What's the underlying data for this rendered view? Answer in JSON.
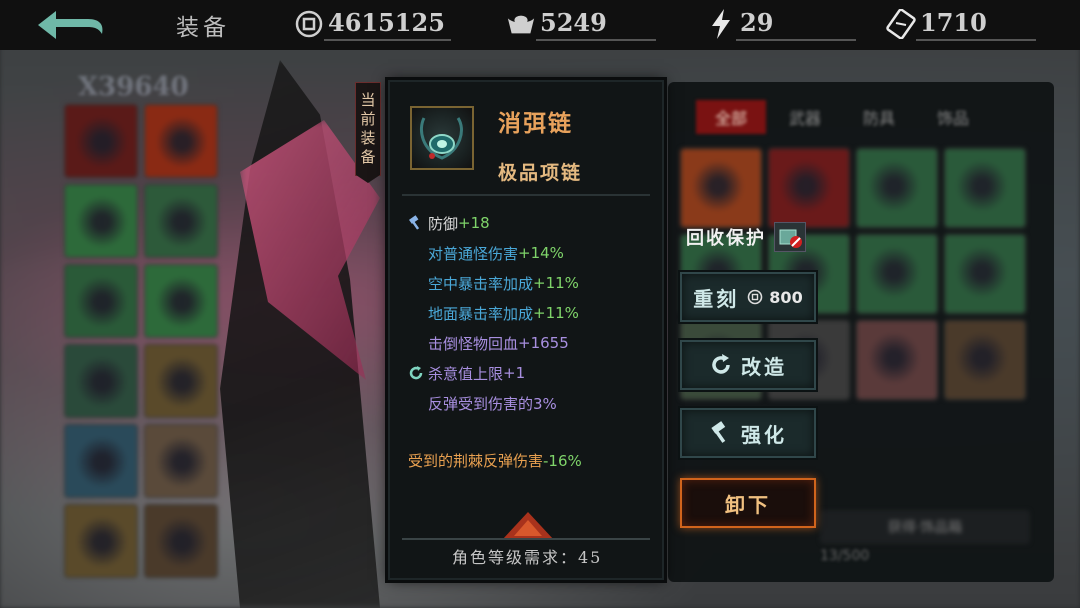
{
  "topbar": {
    "title": "装备",
    "resources": [
      {
        "icon": "coin-icon",
        "value": "4615125"
      },
      {
        "icon": "ingot-icon",
        "value": "5249"
      },
      {
        "icon": "lightning-icon",
        "value": "29"
      },
      {
        "icon": "ticket-icon",
        "value": "1710"
      }
    ]
  },
  "inventory_left": {
    "count": "X39640"
  },
  "current_tag": {
    "chars": [
      "当",
      "前",
      "装",
      "备"
    ]
  },
  "item": {
    "name": "消弭链",
    "type": "极品项链",
    "stats": [
      {
        "label": "防御",
        "value": "+18"
      },
      {
        "label": "对普通怪伤害",
        "value": "+14%"
      },
      {
        "label": "空中暴击率加成",
        "value": "+11%"
      },
      {
        "label": "地面暴击率加成",
        "value": "+11%"
      },
      {
        "label": "击倒怪物回血",
        "value": "+1655"
      },
      {
        "label": "杀意值上限",
        "value": "+1"
      },
      {
        "label": "反弹受到伤害的3%",
        "value": ""
      }
    ],
    "special": {
      "label": "受到的荆棘反弹伤害",
      "value": "-16%"
    },
    "requirement": "角色等级需求：45"
  },
  "right_panel": {
    "tabs": [
      "全部",
      "武器",
      "防具",
      "饰品"
    ],
    "footer_label": "获得·饰品箱",
    "count": "13/500"
  },
  "actions": {
    "protect_label": "回收保护",
    "reforge_label": "重刻",
    "reforge_cost": "800",
    "remake_label": "改造",
    "enhance_label": "强化",
    "unequip_label": "卸下"
  },
  "colors": {
    "name": "#e8a25c",
    "type": "#e4b980",
    "stat_blue": "#4aa8d8",
    "stat_green": "#7fd46a",
    "stat_violet": "#a88fe0",
    "special_orange": "#e8a050",
    "unequip_border": "#d0641c"
  }
}
